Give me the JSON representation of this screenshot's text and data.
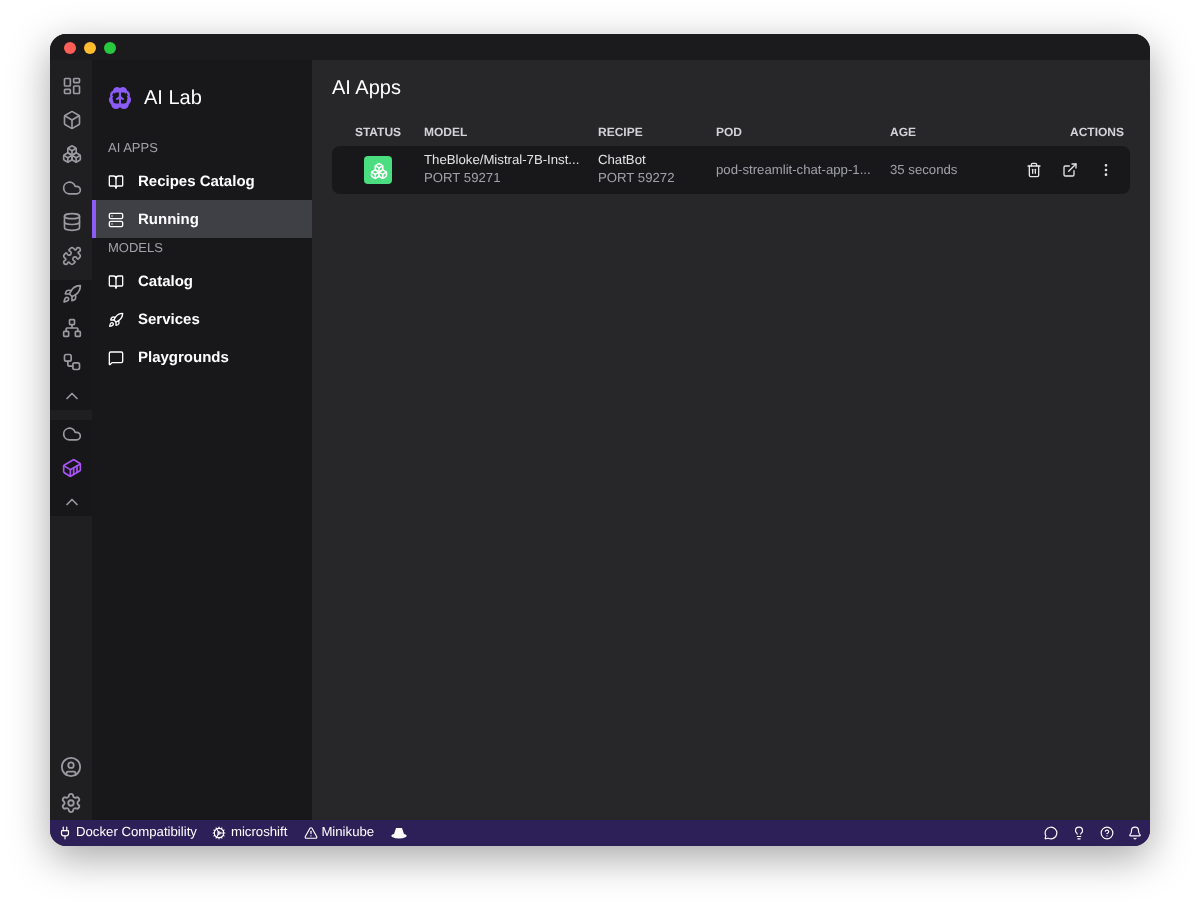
{
  "sidebar": {
    "title": "AI Lab",
    "sections": [
      {
        "heading": "AI APPS",
        "items": [
          {
            "label": "Recipes Catalog",
            "kind": "book",
            "selected": false
          },
          {
            "label": "Running",
            "kind": "server",
            "selected": true
          }
        ]
      },
      {
        "heading": "MODELS",
        "items": [
          {
            "label": "Catalog",
            "kind": "book",
            "selected": false
          },
          {
            "label": "Services",
            "kind": "rocket",
            "selected": false
          },
          {
            "label": "Playgrounds",
            "kind": "chat",
            "selected": false
          }
        ]
      }
    ]
  },
  "page": {
    "title": "AI Apps"
  },
  "table": {
    "columns": [
      "STATUS",
      "MODEL",
      "RECIPE",
      "POD",
      "AGE",
      "ACTIONS"
    ],
    "rows": [
      {
        "model": "TheBloke/Mistral-7B-Inst...",
        "model_port": "PORT 59271",
        "recipe": "ChatBot",
        "recipe_port": "PORT 59272",
        "pod": "pod-streamlit-chat-app-1...",
        "age": "35 seconds"
      }
    ]
  },
  "status_bar": {
    "items": [
      {
        "kind": "plug",
        "label": "Docker Compatibility"
      },
      {
        "kind": "gear",
        "label": "microshift"
      },
      {
        "kind": "warning",
        "label": "Minikube"
      },
      {
        "kind": "hat"
      }
    ]
  }
}
